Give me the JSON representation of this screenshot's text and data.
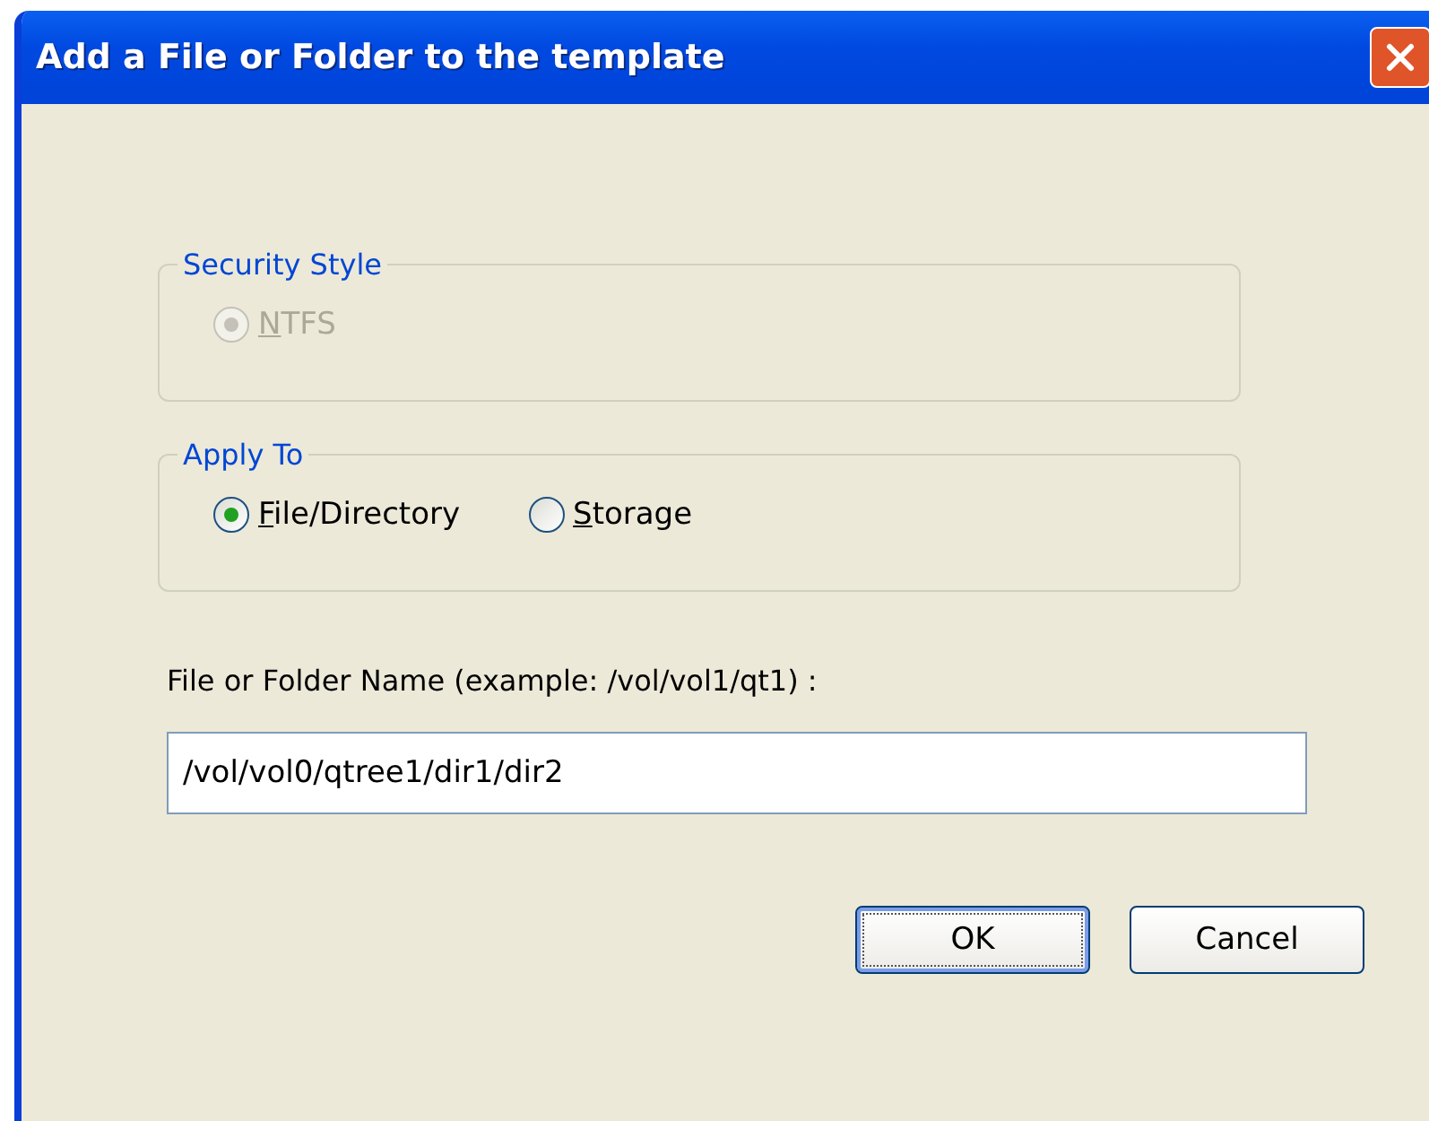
{
  "window": {
    "title": "Add a File or Folder to the template"
  },
  "groups": [
    {
      "title": "Security Style",
      "options": [
        {
          "label": "NTFS",
          "selected": true,
          "disabled": true
        }
      ]
    },
    {
      "title": "Apply To",
      "options": [
        {
          "label": "File/Directory",
          "selected": true,
          "disabled": false
        },
        {
          "label": "Storage",
          "selected": false,
          "disabled": false
        }
      ]
    }
  ],
  "name_field": {
    "label": "File or Folder Name (example: /vol/vol1/qt1) :",
    "value": "/vol/vol0/qtree1/dir1/dir2"
  },
  "buttons": [
    {
      "label": "OK",
      "default": true
    },
    {
      "label": "Cancel",
      "default": false
    }
  ]
}
